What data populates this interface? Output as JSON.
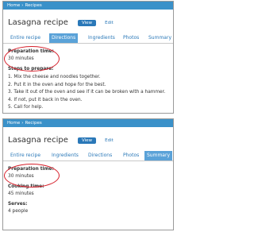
{
  "colors": {
    "header": "#3a91c9",
    "active_tab": "#5aa2d8",
    "view_button": "#2a78b8",
    "link": "#2a78b8",
    "highlight_ring": "#d61f2a"
  },
  "screens": [
    {
      "breadcrumb": {
        "home": "Home",
        "sep": "›",
        "section": "Recipes"
      },
      "title": "Lasagna recipe",
      "view_label": "View",
      "edit_label": "Edit",
      "tabs": [
        "Entire recipe",
        "Directions",
        "Ingredients",
        "Photos",
        "Summary"
      ],
      "active_tab": "Directions",
      "prep_label": "Preparation time:",
      "prep_value": "30 minutes",
      "steps_label": "Steps to prepare:",
      "steps": [
        "1. Mix the cheese and noodles together.",
        "2. Put it in the oven and hope for the best.",
        "3. Take it out of the oven and see if it can be broken with a hammer.",
        "4. If not, put it back in the oven.",
        "5. Call for help."
      ]
    },
    {
      "breadcrumb": {
        "home": "Home",
        "sep": "›",
        "section": "Recipes"
      },
      "title": "Lasagna recipe",
      "view_label": "View",
      "edit_label": "Edit",
      "tabs": [
        "Entire recipe",
        "Ingredients",
        "Directions",
        "Photos",
        "Summary"
      ],
      "active_tab": "Summary",
      "prep_label": "Preparation time:",
      "prep_value": "30 minutes",
      "cook_label": "Cooking time:",
      "cook_value": "45 minutes",
      "serves_label": "Serves:",
      "serves_value": "4 people"
    }
  ]
}
